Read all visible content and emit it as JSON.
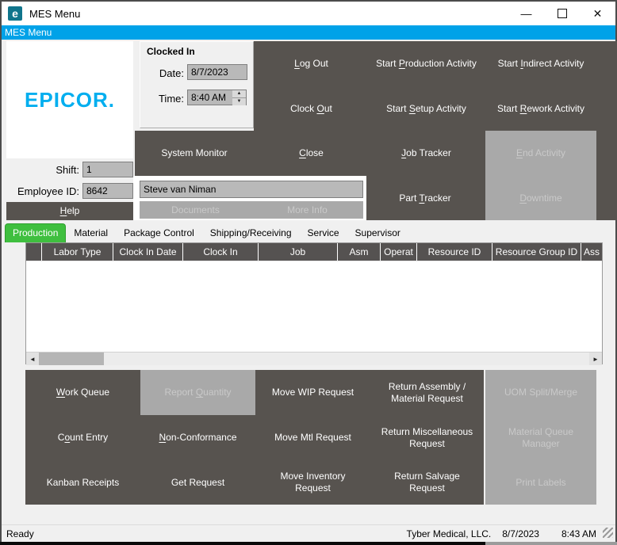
{
  "titlebar": {
    "title": "MES Menu"
  },
  "menubar": {
    "label": "MES Menu"
  },
  "icons": {
    "minimize_glyph": "—",
    "close_glyph": "✕",
    "spin_up": "▲",
    "spin_down": "▼",
    "scroll_left": "◄",
    "scroll_right": "►",
    "app_letter": "e"
  },
  "branding": {
    "logo_text": "EPICOR."
  },
  "session": {
    "shift_label": "Shift:",
    "shift_value": "1",
    "employee_label": "Employee ID:",
    "employee_value": "8642",
    "help": {
      "pre": "",
      "key": "H",
      "post": "elp"
    }
  },
  "clocked_in": {
    "title": "Clocked In",
    "date_label": "Date:",
    "date_value": "8/7/2023",
    "time_label": "Time:",
    "time_value": "8:40 AM"
  },
  "actions": {
    "log_out": {
      "pre": "",
      "key": "L",
      "post": "og Out"
    },
    "start_production": {
      "pre": "Start ",
      "key": "P",
      "post": "roduction Activity"
    },
    "start_indirect": {
      "pre": "Start ",
      "key": "I",
      "post": "ndirect Activity"
    },
    "clock_out": {
      "pre": "Clock ",
      "key": "O",
      "post": "ut"
    },
    "start_setup": {
      "pre": "Start ",
      "key": "S",
      "post": "etup Activity"
    },
    "start_rework": {
      "pre": "Start ",
      "key": "R",
      "post": "ework Activity"
    },
    "system_monitor": {
      "pre": "System Monitor",
      "key": "",
      "post": ""
    },
    "close": {
      "pre": "",
      "key": "C",
      "post": "lose"
    },
    "job_tracker": {
      "pre": "",
      "key": "J",
      "post": "ob Tracker"
    },
    "end_activity": {
      "pre": "",
      "key": "E",
      "post": "nd Activity"
    },
    "part_tracker": {
      "pre": "Part ",
      "key": "T",
      "post": "racker"
    },
    "downtime": {
      "pre": "",
      "key": "D",
      "post": "owntime"
    }
  },
  "identity": {
    "name": "Steve van Niman",
    "documents": "Documents",
    "more_info": "More Info"
  },
  "tabs": [
    {
      "label": "Production",
      "active": true
    },
    {
      "label": "Material",
      "active": false
    },
    {
      "label": "Package Control",
      "active": false
    },
    {
      "label": "Shipping/Receiving",
      "active": false
    },
    {
      "label": "Service",
      "active": false
    },
    {
      "label": "Supervisor",
      "active": false
    }
  ],
  "grid": {
    "columns": [
      "",
      "Labor Type",
      "Clock In Date",
      "Clock In",
      "Job",
      "Asm",
      "Operat",
      "Resource ID",
      "Resource Group ID",
      "Ass"
    ]
  },
  "bottom_actions": {
    "work_queue": {
      "pre": "",
      "key": "W",
      "post": "ork Queue"
    },
    "report_quantity": {
      "pre": "Report ",
      "key": "Q",
      "post": "uantity"
    },
    "move_wip": {
      "pre": "Move WIP Request",
      "key": "",
      "post": ""
    },
    "return_assembly": {
      "pre": "Return Assembly / Material Request",
      "key": "",
      "post": ""
    },
    "count_entry": {
      "pre": "C",
      "key": "o",
      "post": "unt Entry"
    },
    "non_conformance": {
      "pre": "",
      "key": "N",
      "post": "on-Conformance"
    },
    "move_mtl": {
      "pre": "Move Mtl Request",
      "key": "",
      "post": ""
    },
    "return_misc": {
      "pre": "Return Miscellaneous Request",
      "key": "",
      "post": ""
    },
    "kanban_receipts": {
      "pre": "Kanban Receipts",
      "key": "",
      "post": ""
    },
    "get_request": {
      "pre": "Get Request",
      "key": "",
      "post": ""
    },
    "move_inventory": {
      "pre": "Move Inventory Request",
      "key": "",
      "post": ""
    },
    "return_salvage": {
      "pre": "Return Salvage Request",
      "key": "",
      "post": ""
    },
    "uom_split": {
      "pre": "UOM Split/Merge",
      "key": "",
      "post": ""
    },
    "material_queue_manager": {
      "pre": "Material Queue Manager",
      "key": "",
      "post": ""
    },
    "print_labels": {
      "pre": "Print Labels",
      "key": "",
      "post": ""
    }
  },
  "statusbar": {
    "ready": "Ready",
    "company": "Tyber Medical, LLC.",
    "date": "8/7/2023",
    "time": "8:43 AM"
  },
  "colors": {
    "accent_blue": "#00a2e8",
    "tab_green": "#3fbf3f",
    "button_dark": "#57534f",
    "disabled_gray": "#a9a9a9",
    "epicor_cyan": "#00aeef"
  }
}
